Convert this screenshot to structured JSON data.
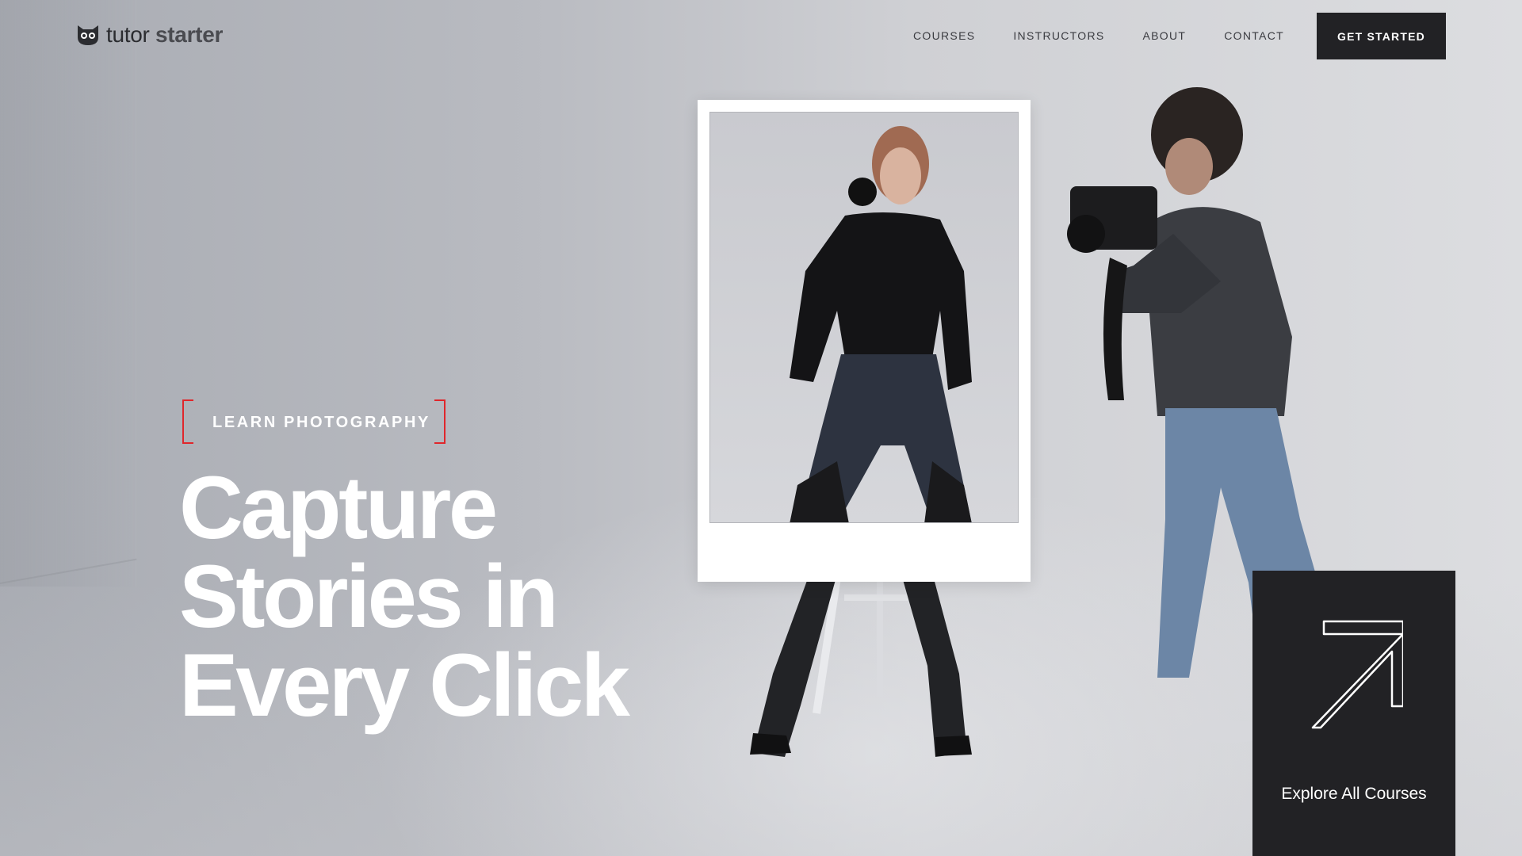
{
  "logo": {
    "text_main": "tutor",
    "text_bold": "starter",
    "icon": "owl-icon"
  },
  "nav": {
    "items": [
      "COURSES",
      "INSTRUCTORS",
      "ABOUT",
      "CONTACT"
    ],
    "cta_label": "GET STARTED"
  },
  "hero": {
    "eyebrow": "LEARN PHOTOGRAPHY",
    "headline_lines": [
      "Capture",
      "Stories in",
      "Every Click"
    ]
  },
  "explore": {
    "label": "Explore All Courses",
    "icon": "arrow-up-right-icon"
  },
  "colors": {
    "accent": "#e0262b",
    "dark": "#222225",
    "text_light": "#ffffff"
  }
}
